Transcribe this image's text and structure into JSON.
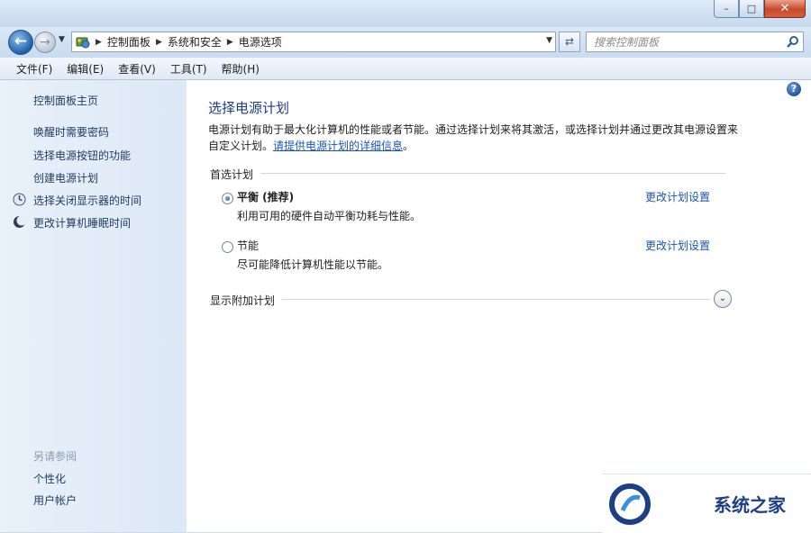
{
  "window": {
    "minimize_icon": "minimize-icon",
    "maximize_icon": "maximize-icon",
    "close_icon": "close-icon"
  },
  "nav": {
    "breadcrumbs": [
      "控制面板",
      "系统和安全",
      "电源选项"
    ],
    "search_placeholder": "搜索控制面板"
  },
  "menu": [
    "文件(F)",
    "编辑(E)",
    "查看(V)",
    "工具(T)",
    "帮助(H)"
  ],
  "sidebar": {
    "home": "控制面板主页",
    "items": [
      "唤醒时需要密码",
      "选择电源按钮的功能",
      "创建电源计划",
      "选择关闭显示器的时间",
      "更改计算机睡眠时间"
    ],
    "see_also_title": "另请参阅",
    "see_also": [
      "个性化",
      "用户帐户"
    ]
  },
  "main": {
    "title": "选择电源计划",
    "description": "电源计划有助于最大化计算机的性能或者节能。通过选择计划来将其激活，或选择计划并通过更改其电源设置来自定义计划。",
    "description_link": "请提供电源计划的详细信息",
    "description_end": "。",
    "preferred_section": "首选计划",
    "plans": [
      {
        "name": "平衡 (推荐)",
        "desc": "利用可用的硬件自动平衡功耗与性能。",
        "link": "更改计划设置",
        "selected": true
      },
      {
        "name": "节能",
        "desc": "尽可能降低计算机性能以节能。",
        "link": "更改计划设置",
        "selected": false
      }
    ],
    "additional_section": "显示附加计划"
  },
  "watermark": {
    "text": "系统之家"
  },
  "colors": {
    "link": "#1a55b5",
    "title": "#1e3a8a",
    "sidebar_bg": "#e9f1fa"
  }
}
